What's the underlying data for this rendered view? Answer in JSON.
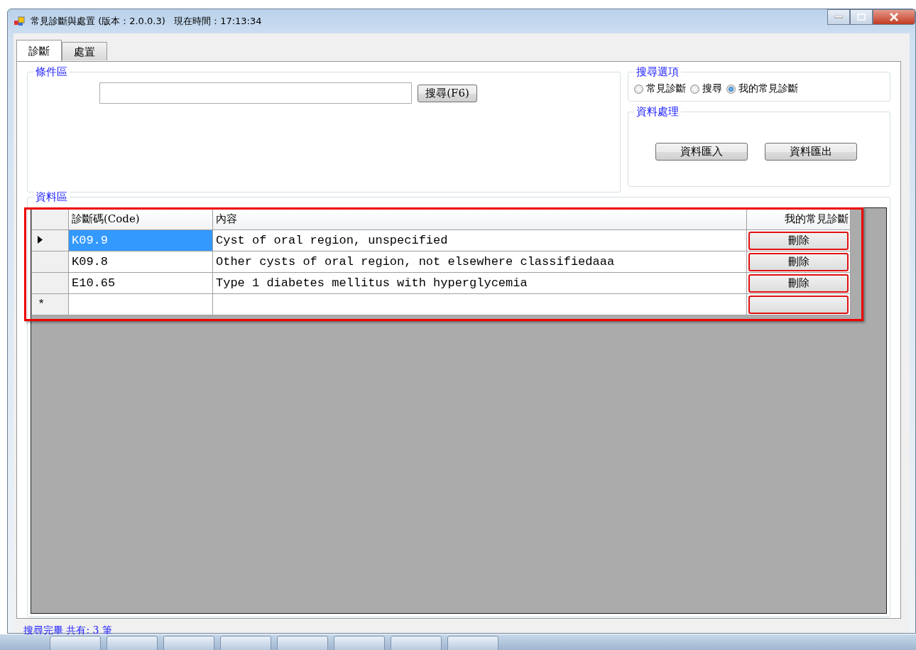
{
  "window": {
    "title": "常見診斷與處置 (版本：2.0.0.3)   現在時間：17:13:34"
  },
  "tabs": [
    {
      "label": "診斷",
      "selected": true
    },
    {
      "label": "處置",
      "selected": false
    }
  ],
  "criteria": {
    "title": "條件區",
    "search_button": "搜尋(F6)"
  },
  "search_options": {
    "title": "搜尋選項",
    "options": [
      {
        "label": "常見診斷",
        "selected": false
      },
      {
        "label": "搜尋",
        "selected": false
      },
      {
        "label": "我的常見診斷",
        "selected": true
      }
    ]
  },
  "data_processing": {
    "title": "資料處理",
    "buttons": [
      "資料匯入",
      "資料匯出"
    ]
  },
  "data_area": {
    "title": "資料區",
    "table": {
      "columns": [
        "診斷碼(Code)",
        "內容",
        "我的常見診斷"
      ],
      "rows": [
        {
          "code": "K09.9",
          "content": "Cyst of oral region, unspecified",
          "action": "刪除",
          "selected": true
        },
        {
          "code": "K09.8",
          "content": "Other cysts of oral region, not elsewhere classifiedaaa",
          "action": "刪除",
          "selected": false
        },
        {
          "code": "E10.65",
          "content": "Type 1 diabetes mellitus with hyperglycemia",
          "action": "刪除",
          "selected": false
        }
      ],
      "new_row_marker": "*"
    }
  },
  "status_bar": "搜尋完畢 共有: 3 筆"
}
